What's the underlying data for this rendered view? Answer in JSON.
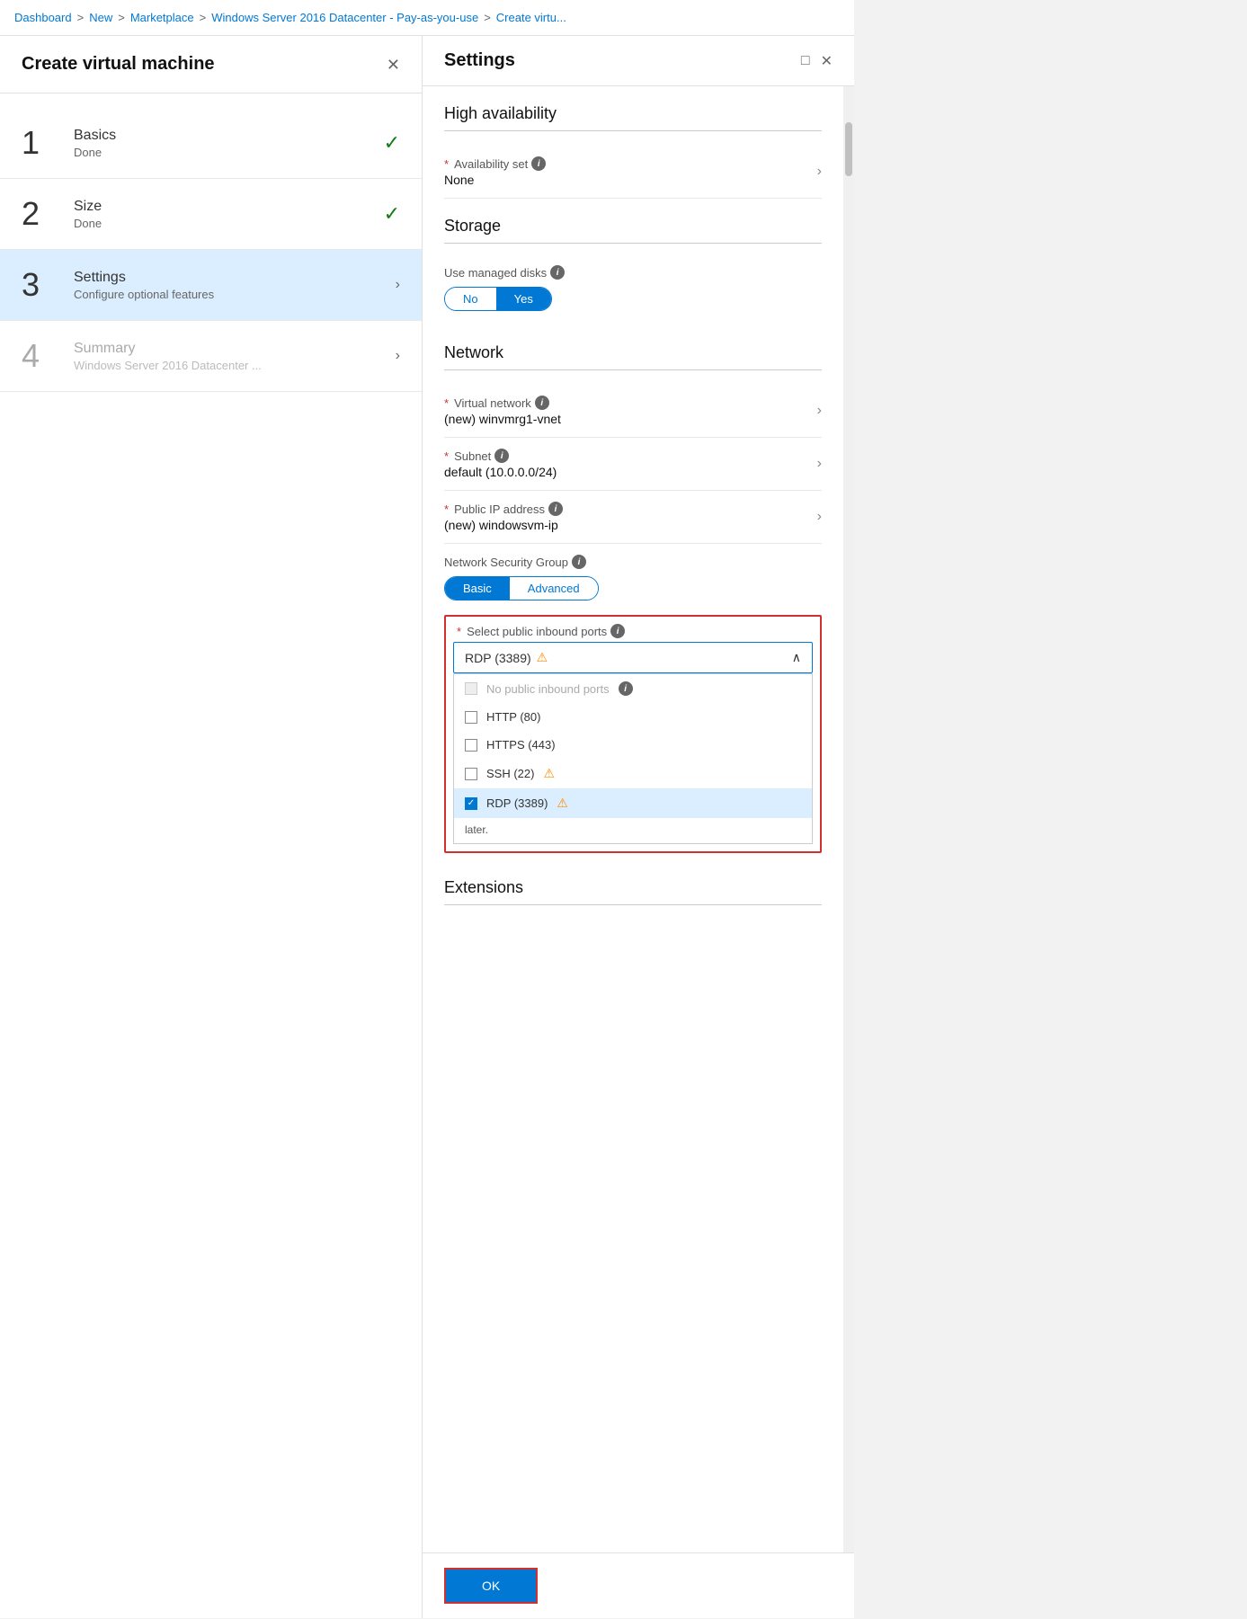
{
  "breadcrumb": {
    "items": [
      "Dashboard",
      "New",
      "Marketplace",
      "Windows Server 2016 Datacenter - Pay-as-you-use",
      "Create virtu..."
    ],
    "separators": [
      ">",
      ">",
      ">",
      ">"
    ]
  },
  "left_panel": {
    "title": "Create virtual machine",
    "steps": [
      {
        "number": "1",
        "name": "Basics",
        "sub": "Done",
        "status": "done",
        "active": false
      },
      {
        "number": "2",
        "name": "Size",
        "sub": "Done",
        "status": "done",
        "active": false
      },
      {
        "number": "3",
        "name": "Settings",
        "sub": "Configure optional features",
        "status": "active",
        "active": true
      },
      {
        "number": "4",
        "name": "Summary",
        "sub": "Windows Server 2016 Datacenter ...",
        "status": "pending",
        "active": false
      }
    ]
  },
  "right_panel": {
    "title": "Settings",
    "sections": {
      "high_availability": {
        "title": "High availability",
        "availability_set": {
          "label": "Availability set",
          "value": "None",
          "required": true
        }
      },
      "storage": {
        "title": "Storage",
        "managed_disks": {
          "label": "Use managed disks",
          "options": [
            "No",
            "Yes"
          ],
          "selected": "Yes"
        }
      },
      "network": {
        "title": "Network",
        "virtual_network": {
          "label": "Virtual network",
          "value": "(new) winvmrg1-vnet",
          "required": true
        },
        "subnet": {
          "label": "Subnet",
          "value": "default (10.0.0.0/24)",
          "required": true
        },
        "public_ip": {
          "label": "Public IP address",
          "value": "(new) windowsvm-ip",
          "required": true
        },
        "nsg": {
          "label": "Network Security Group",
          "options": [
            "Basic",
            "Advanced"
          ],
          "selected": "Basic"
        },
        "inbound_ports": {
          "label": "Select public inbound ports",
          "selected_display": "RDP (3389)",
          "has_warning": true,
          "options": [
            {
              "id": "no_ports",
              "label": "No public inbound ports",
              "checked": false,
              "disabled": true,
              "has_info": true
            },
            {
              "id": "http",
              "label": "HTTP (80)",
              "checked": false,
              "disabled": false,
              "has_info": false
            },
            {
              "id": "https",
              "label": "HTTPS (443)",
              "checked": false,
              "disabled": false,
              "has_info": false
            },
            {
              "id": "ssh",
              "label": "SSH (22)",
              "checked": false,
              "disabled": false,
              "has_warning": true
            },
            {
              "id": "rdp",
              "label": "RDP (3389)",
              "checked": true,
              "disabled": false,
              "has_warning": true
            }
          ],
          "note": "later.",
          "required": true
        }
      },
      "extensions": {
        "title": "Extensions"
      }
    },
    "ok_button": "OK"
  },
  "icons": {
    "check": "✓",
    "chevron_right": "›",
    "chevron_up": "∧",
    "chevron_down": "∨",
    "close": "✕",
    "maximize": "□",
    "warning": "⚠",
    "info": "i",
    "checked": "✓"
  }
}
